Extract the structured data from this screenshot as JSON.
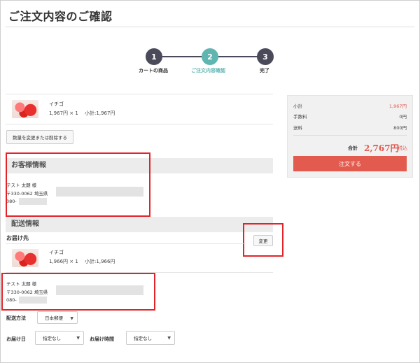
{
  "page": {
    "title": "ご注文内容のご確認"
  },
  "stepper": {
    "steps": [
      {
        "number": "1",
        "label": "カートの商品",
        "state": "done"
      },
      {
        "number": "2",
        "label": "ご注文内容確認",
        "state": "current"
      },
      {
        "number": "3",
        "label": "完了",
        "state": "pending"
      }
    ],
    "colors": {
      "done": "#4a4a5a",
      "current": "#5fb5b0"
    }
  },
  "cart_item": {
    "name": "イチゴ",
    "price_line": "1,967円 × 1　 小計:1,967円",
    "change_button": "数量を変更または削除する"
  },
  "customer": {
    "heading": "お客様情報",
    "name": "テスト 太朗 様",
    "address": "〒330-0062 埼玉県",
    "phone": "080-"
  },
  "shipping": {
    "heading": "配送情報",
    "dest_label": "お届け先",
    "change_button": "変更",
    "item_name": "イチゴ",
    "item_price_line": "1,966円 × 1　 小計:1,966円",
    "name": "テスト 太朗 様",
    "address": "〒330-0062 埼玉県",
    "phone": "080-",
    "method_label": "配送方法",
    "method_value": "日本郵便",
    "date_label": "お届け日",
    "date_value": "指定なし",
    "time_label": "お届け時間",
    "time_value": "指定なし"
  },
  "summary": {
    "subtotal_label": "小計",
    "subtotal_value": "1,967円",
    "fee_label": "手数料",
    "fee_value": "0円",
    "shipping_label": "送料",
    "shipping_value": "800円",
    "total_label": "合計",
    "total_value": "2,767円",
    "tax_label": "税込",
    "order_button": "注文する"
  }
}
